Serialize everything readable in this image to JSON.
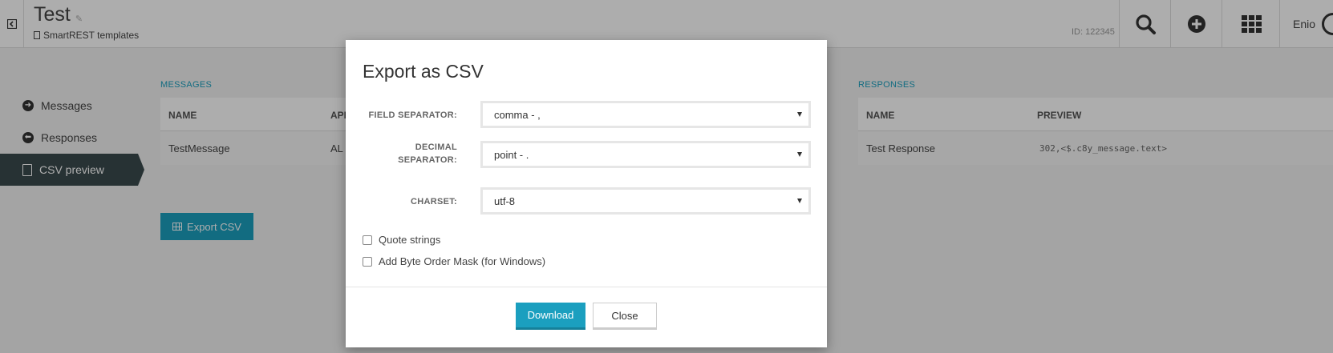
{
  "header": {
    "title": "Test",
    "breadcrumb": "SmartREST templates",
    "device_id": "ID: 122345",
    "user_name": "Enio"
  },
  "sidebar": {
    "items": [
      {
        "label": "Messages",
        "icon": "arrow-right-circle-icon"
      },
      {
        "label": "Responses",
        "icon": "arrow-left-circle-icon"
      },
      {
        "label": "CSV preview",
        "icon": "document-code-icon",
        "active": true
      }
    ]
  },
  "messages": {
    "section_label": "MESSAGES",
    "columns": [
      "NAME",
      "API"
    ],
    "rows": [
      {
        "name": "TestMessage",
        "api": "AL"
      }
    ]
  },
  "responses": {
    "section_label": "RESPONSES",
    "columns": [
      "NAME",
      "PREVIEW"
    ],
    "rows": [
      {
        "name": "Test Response",
        "preview": "302,<$.c8y_message.text>"
      }
    ]
  },
  "export_button": "Export CSV",
  "modal": {
    "title": "Export as CSV",
    "fields": {
      "field_separator": {
        "label": "FIELD SEPARATOR:",
        "value": "comma - ,"
      },
      "decimal_separator": {
        "label_line1": "DECIMAL",
        "label_line2": "SEPARATOR:",
        "value": "point - ."
      },
      "charset": {
        "label": "CHARSET:",
        "value": "utf-8"
      }
    },
    "checkboxes": {
      "quote_strings": "Quote strings",
      "byte_order_mask": "Add Byte Order Mask (for Windows)"
    },
    "download_label": "Download",
    "close_label": "Close"
  },
  "colors": {
    "accent": "#1b9fbf",
    "sidebar_active": "#3a4a4d"
  }
}
